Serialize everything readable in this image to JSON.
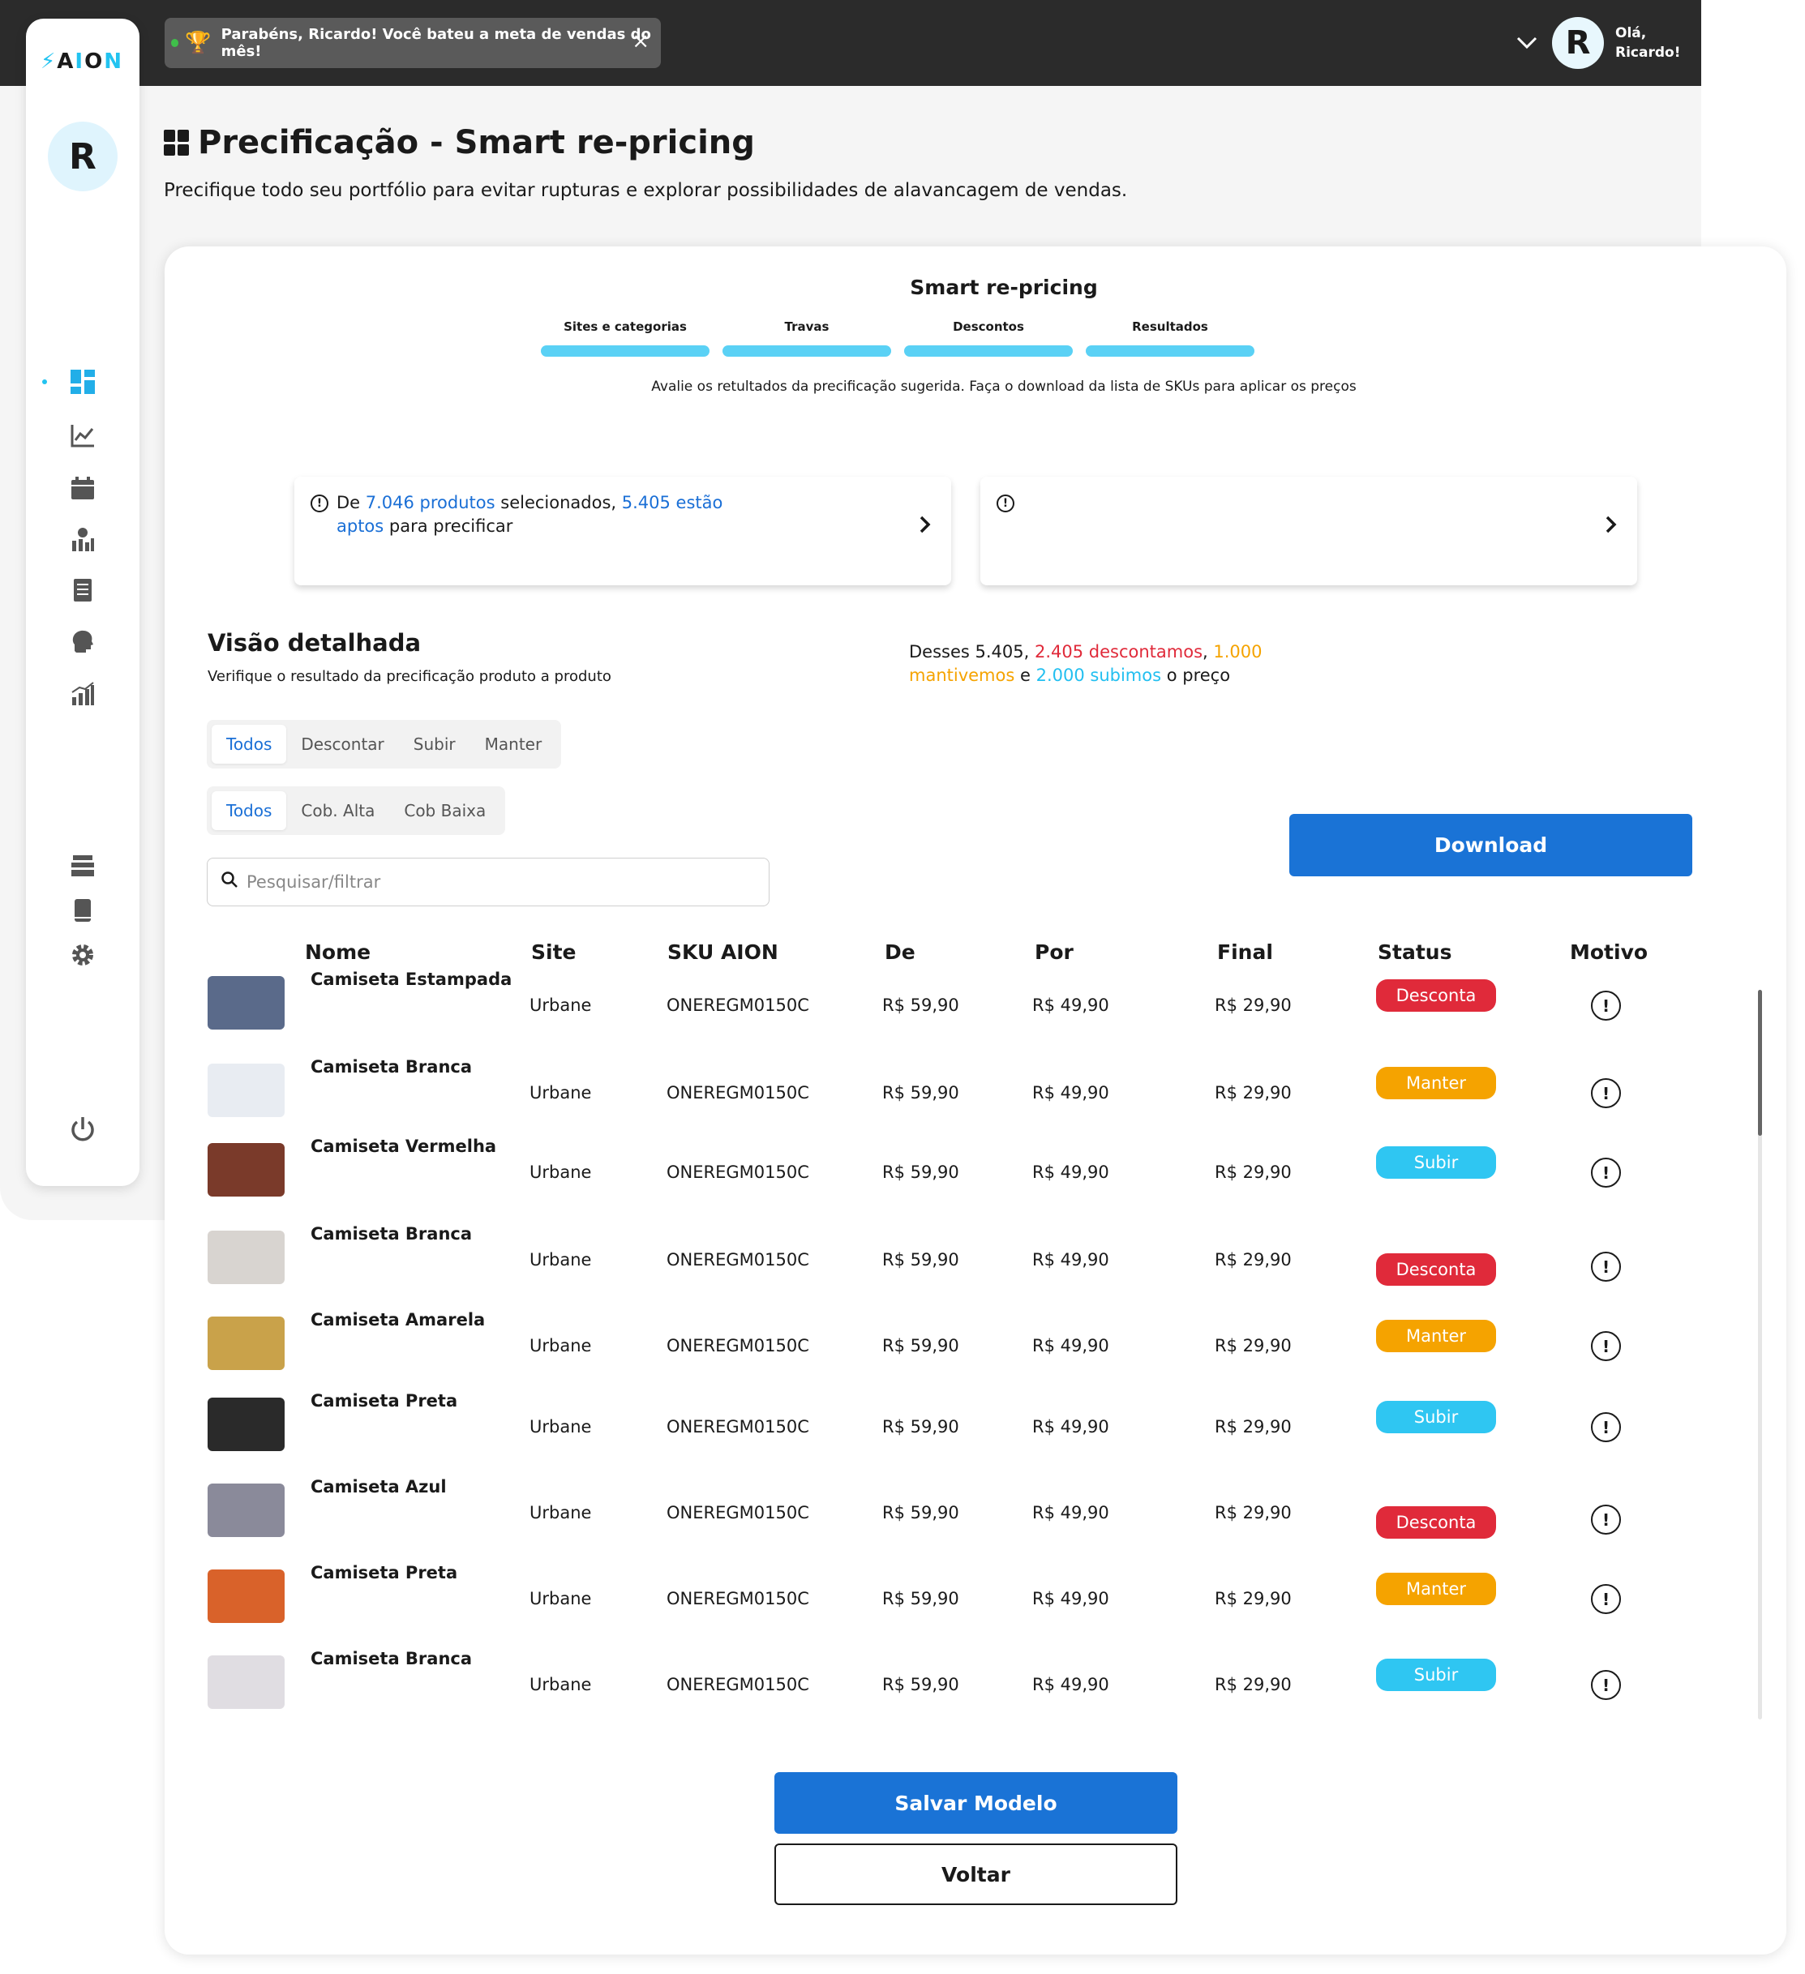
{
  "toast": {
    "message": "Parabéns, Ricardo! Você bateu a meta de vendas do mês!",
    "close": "×"
  },
  "user": {
    "initial": "R",
    "greeting_1": "Olá,",
    "greeting_2": "Ricardo!"
  },
  "sidebar": {
    "logo_prefix": "A",
    "logo_accent_1": "I",
    "logo_mid": "O",
    "logo_accent_2": "N",
    "avatar_initial": "R"
  },
  "header": {
    "title": "Precificação - Smart re-pricing",
    "subtitle": "Precifique todo seu portfólio para evitar rupturas e explorar possibilidades de alavancagem de vendas."
  },
  "wizard": {
    "title": "Smart re-pricing",
    "steps": [
      "Sites e categorias",
      "Travas",
      "Descontos",
      "Resultados"
    ],
    "hint": "Avalie os retultados da precificação sugerida. Faça o download da lista de SKUs para aplicar os preços"
  },
  "info": {
    "t1": "De ",
    "t2": "7.046 produtos",
    "t3": " selecionados, ",
    "t4": "5.405 estão aptos",
    "t5": " para precificar"
  },
  "section": {
    "title": "Visão detalhada",
    "subtitle": "Verifique o resultado da precificação produto a produto"
  },
  "summary": {
    "s1": "Desses 5.405, ",
    "s2": "2.405 descontamos",
    "s3": ", ",
    "s4": "1.000 mantivemos",
    "s5": " e ",
    "s6": "2.000 subimos",
    "s7": " o preço"
  },
  "filters1": [
    "Todos",
    "Descontar",
    "Subir",
    "Manter"
  ],
  "filters2": [
    "Todos",
    "Cob. Alta",
    "Cob Baixa"
  ],
  "search": {
    "placeholder": "Pesquisar/filtrar"
  },
  "download_label": "Download",
  "table": {
    "headers": {
      "nome": "Nome",
      "site": "Site",
      "sku": "SKU AION",
      "de": "De",
      "por": "Por",
      "final": "Final",
      "status": "Status",
      "motivo": "Motivo"
    },
    "rows": [
      {
        "nome": "Camiseta Estampada",
        "site": "Urbane",
        "sku": "ONEREGM0150C",
        "de": "R$ 59,90",
        "por": "R$ 49,90",
        "final": "R$ 29,90",
        "status": "Desconta"
      },
      {
        "nome": "Camiseta Branca",
        "site": "Urbane",
        "sku": "ONEREGM0150C",
        "de": "R$ 59,90",
        "por": "R$ 49,90",
        "final": "R$ 29,90",
        "status": "Manter"
      },
      {
        "nome": "Camiseta Vermelha",
        "site": "Urbane",
        "sku": "ONEREGM0150C",
        "de": "R$ 59,90",
        "por": "R$ 49,90",
        "final": "R$ 29,90",
        "status": "Subir"
      },
      {
        "nome": "Camiseta Branca",
        "site": "Urbane",
        "sku": "ONEREGM0150C",
        "de": "R$ 59,90",
        "por": "R$ 49,90",
        "final": "R$ 29,90",
        "status": "Desconta"
      },
      {
        "nome": "Camiseta Amarela",
        "site": "Urbane",
        "sku": "ONEREGM0150C",
        "de": "R$ 59,90",
        "por": "R$ 49,90",
        "final": "R$ 29,90",
        "status": "Manter"
      },
      {
        "nome": "Camiseta Preta",
        "site": "Urbane",
        "sku": "ONEREGM0150C",
        "de": "R$ 59,90",
        "por": "R$ 49,90",
        "final": "R$ 29,90",
        "status": "Subir"
      },
      {
        "nome": "Camiseta Azul",
        "site": "Urbane",
        "sku": "ONEREGM0150C",
        "de": "R$ 59,90",
        "por": "R$ 49,90",
        "final": "R$ 29,90",
        "status": "Desconta"
      },
      {
        "nome": "Camiseta Preta",
        "site": "Urbane",
        "sku": "ONEREGM0150C",
        "de": "R$ 59,90",
        "por": "R$ 49,90",
        "final": "R$ 29,90",
        "status": "Manter"
      },
      {
        "nome": "Camiseta Branca",
        "site": "Urbane",
        "sku": "ONEREGM0150C",
        "de": "R$ 59,90",
        "por": "R$ 49,90",
        "final": "R$ 29,90",
        "status": "Subir"
      }
    ]
  },
  "status_colors": {
    "Desconta": "#e02a3a",
    "Manter": "#f5a300",
    "Subir": "#2fc6f2"
  },
  "thumb_colors": [
    "#5a6a8a",
    "#e8ecf2",
    "#7a3a2a",
    "#d8d4d0",
    "#c9a24a",
    "#2a2a2a",
    "#8a8a9a",
    "#d9622a",
    "#e0dde2"
  ],
  "actions": {
    "save": "Salvar Modelo",
    "back": "Voltar"
  }
}
